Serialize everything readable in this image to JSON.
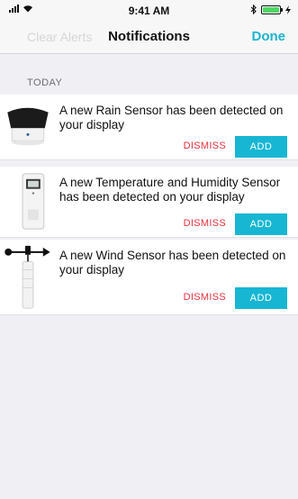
{
  "status_bar": {
    "time": "9:41 AM",
    "icons": [
      "signal-icon",
      "wifi-icon",
      "bluetooth-icon",
      "battery-icon",
      "charging-icon"
    ]
  },
  "nav": {
    "left_label": "Clear Alerts",
    "title": "Notifications",
    "right_label": "Done",
    "accent_color": "#1ab3cf"
  },
  "section": {
    "header": "TODAY"
  },
  "notifications": [
    {
      "icon": "rain-sensor-icon",
      "message": "A new Rain Sensor has been detected on your display",
      "dismiss_label": "DISMISS",
      "add_label": "ADD"
    },
    {
      "icon": "temperature-humidity-sensor-icon",
      "message": "A new Temperature and Humidity Sensor has been detected on your display",
      "dismiss_label": "DISMISS",
      "add_label": "ADD"
    },
    {
      "icon": "wind-sensor-icon",
      "message": "A new Wind Sensor has been detected on your display",
      "dismiss_label": "DISMISS",
      "add_label": "ADD"
    }
  ],
  "colors": {
    "background": "#efeff4",
    "dismiss": "#e8323d",
    "add_button": "#17b6d3"
  }
}
